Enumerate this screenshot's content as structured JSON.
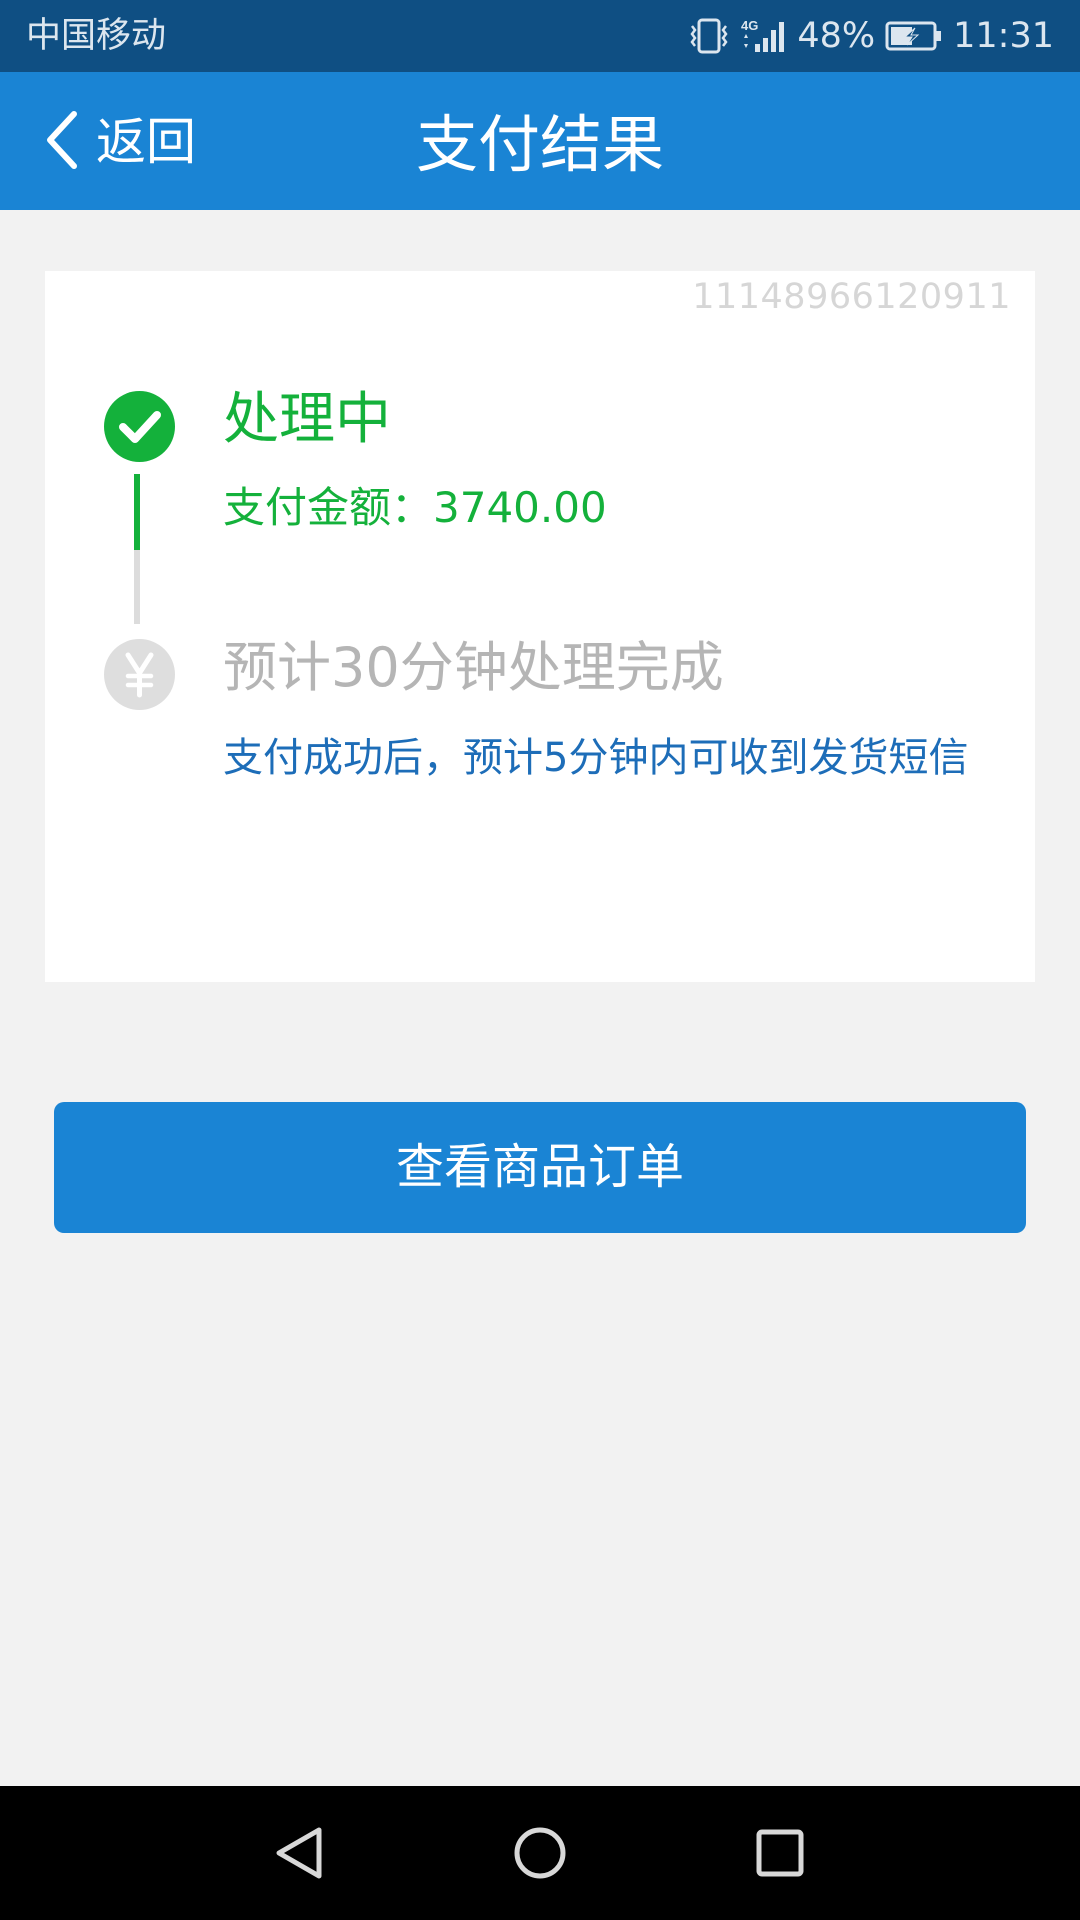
{
  "status_bar": {
    "carrier": "中国移动",
    "network": "4G",
    "battery": "48%",
    "time": "11:31"
  },
  "header": {
    "back_label": "返回",
    "title": "支付结果"
  },
  "result": {
    "order_number": "11148966120911",
    "steps": [
      {
        "title": "处理中",
        "detail": "支付金额：3740.00",
        "state": "done",
        "icon": "check-icon"
      },
      {
        "title": "预计30分钟处理完成",
        "detail": "支付成功后，预计5分钟内可收到发货短信",
        "state": "pending",
        "icon": "yuan-icon"
      }
    ]
  },
  "actions": {
    "view_order_label": "查看商品订单"
  },
  "colors": {
    "status_bar": "#0f4f83",
    "header": "#1a84d4",
    "success": "#14b13b",
    "info_text": "#1d6db8",
    "pending_text": "#b5b5b5",
    "background": "#f2f2f2"
  }
}
